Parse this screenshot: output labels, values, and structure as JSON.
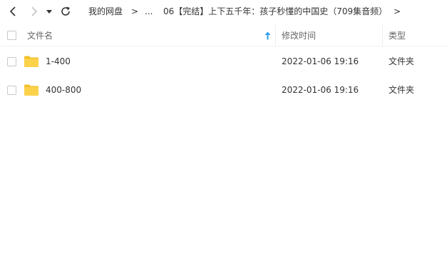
{
  "nav": {
    "breadcrumb": {
      "root": "我的网盘",
      "separator": ">",
      "ellipsis": "...",
      "current": "06【完结】上下五千年：孩子秒懂的中国史（709集音频）",
      "trailing": ">"
    }
  },
  "table": {
    "columns": {
      "name": "文件名",
      "modified": "修改时间",
      "type": "类型"
    },
    "sort_column": "name",
    "rows": [
      {
        "name": "1-400",
        "modified": "2022-01-06 19:16",
        "type": "文件夹"
      },
      {
        "name": "400-800",
        "modified": "2022-01-06 19:16",
        "type": "文件夹"
      }
    ]
  },
  "colors": {
    "folder": "#fcd24a",
    "folder_tab": "#f5c02e",
    "sort_arrow": "#2f9ef0"
  }
}
